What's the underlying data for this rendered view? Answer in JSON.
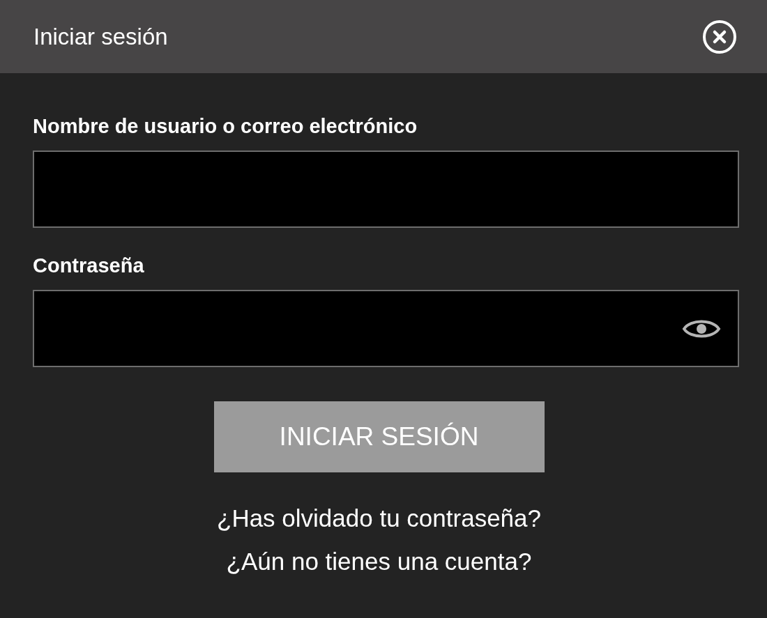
{
  "window": {
    "title": "Iniciar sesión"
  },
  "fields": [
    {
      "label": "Nombre de usuario o correo electrónico",
      "kind": "text"
    },
    {
      "label": "Contraseña",
      "kind": "password"
    }
  ],
  "submit": {
    "label": "INICIAR SESIÓN",
    "disabled": true
  },
  "links": [
    "¿Has olvidado tu contraseña?",
    "¿Aún no tienes una cuenta?"
  ]
}
